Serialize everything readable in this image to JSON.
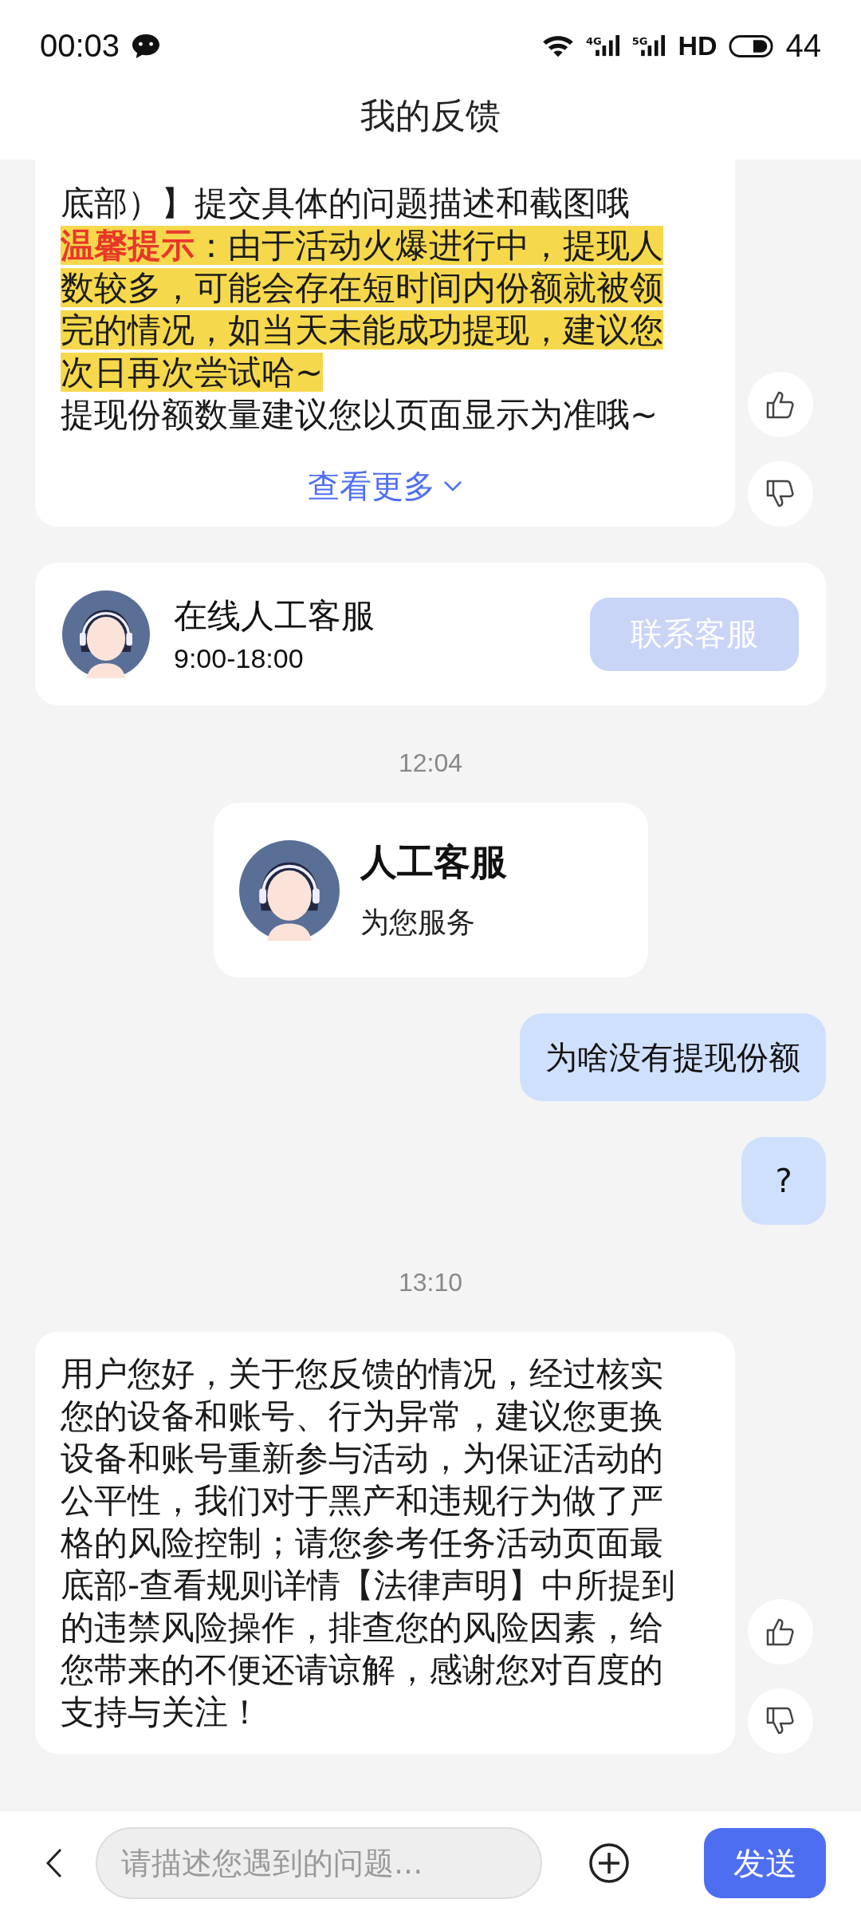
{
  "status_bar": {
    "time": "00:03",
    "networks": [
      "4G",
      "5G"
    ],
    "hd": "HD",
    "battery": "44"
  },
  "header": {
    "title": "我的反馈"
  },
  "messages": [
    {
      "kind": "bot",
      "paragraphs": [
        {
          "kind": "plain",
          "text": "底部）】提交具体的问题描述和截图哦"
        },
        {
          "kind": "tip",
          "text": "**温馨提示**：由于活动火爆进行中，提现人数较多，可能会存在短时间内份额就被领完的情况，如当天未能成功提现，建议您次日再次尝试哈~"
        },
        {
          "kind": "plain",
          "text": "提现份额数量建议您以页面显示为准哦~"
        }
      ],
      "more": "查看更多",
      "votes": true
    },
    {
      "kind": "service_card",
      "title": "在线人工客服",
      "hours": "9:00-18:00",
      "button": "联系客服"
    },
    {
      "kind": "time",
      "text": "12:04"
    },
    {
      "kind": "agent_card",
      "title": "人工客服",
      "subtitle": "为您服务"
    },
    {
      "kind": "user",
      "text": "为啥没有提现份额"
    },
    {
      "kind": "user",
      "text": "?"
    },
    {
      "kind": "time",
      "text": "13:10"
    },
    {
      "kind": "bot",
      "paragraphs": [
        {
          "kind": "plain",
          "text": "用户您好，关于您反馈的情况，经过核实您的设备和账号、行为异常，建议您更换设备和账号重新参与活动，为保证活动的公平性，我们对于黑产和违规行为做了严格的风险控制；请您参考任务活动页面最底部-查看规则详情【法律声明】中所提到的违禁风险操作，排查您的风险因素，给您带来的不便还请谅解，感谢您对百度的支持与关注！"
        }
      ],
      "votes": true
    }
  ],
  "composer": {
    "placeholder": "请描述您遇到的问题...",
    "send": "发送"
  }
}
